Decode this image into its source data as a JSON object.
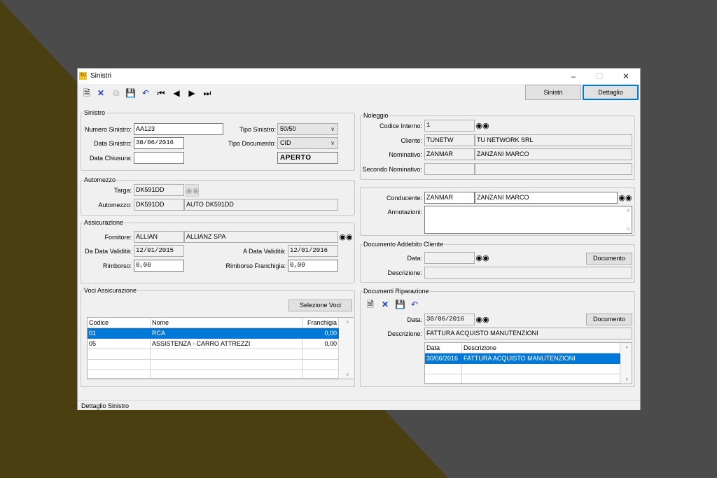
{
  "window": {
    "title": "Sinistri",
    "app_icon_text": "TU"
  },
  "tabs": [
    {
      "label": "Sinistri"
    },
    {
      "label": "Dettaglio"
    }
  ],
  "sinistro": {
    "legend": "Sinistro",
    "numero_label": "Numero Sinistro:",
    "numero_value": "AA123",
    "data_label": "Data Sinistro:",
    "data_value": "30/06/2016",
    "chiusura_label": "Data Chiusura:",
    "chiusura_value": "",
    "tipo_label": "Tipo Sinistro:",
    "tipo_value": "50/50",
    "tipodoc_label": "Tipo Documento:",
    "tipodoc_value": "CID",
    "stato": "APERTO"
  },
  "automezzo": {
    "legend": "Automezzo",
    "targa_label": "Targa:",
    "targa_value": "DK591DD",
    "auto_label": "Automezzo:",
    "auto_code": "DK591DD",
    "auto_desc": "AUTO DK591DD"
  },
  "assicurazione": {
    "legend": "Assicurazione",
    "fornitore_label": "Fornitore:",
    "fornitore_code": "ALLIAN",
    "fornitore_desc": "ALLIANZ SPA",
    "da_label": "Da Data Validità:",
    "da_value": "12/01/2015",
    "a_label": "A Data Validità:",
    "a_value": "12/01/2016",
    "rimborso_label": "Rimborso:",
    "rimborso_value": "0,00",
    "franchigia_label": "Rimborso Franchigia:",
    "franchigia_value": "0,00"
  },
  "voci": {
    "legend": "Voci Assicurazione",
    "button": "Selezione Voci",
    "headers": [
      "Codice",
      "Nome",
      "Franchigia"
    ],
    "rows": [
      {
        "codice": "01",
        "nome": "RCA",
        "franchigia": "0,00"
      },
      {
        "codice": "05",
        "nome": "ASSISTENZA - CARRO ATTREZZI",
        "franchigia": "0,00"
      }
    ]
  },
  "noleggio": {
    "legend": "Noleggio",
    "codice_label": "Codice Interno:",
    "codice_value": "1",
    "cliente_label": "Cliente:",
    "cliente_code": "TUNETW",
    "cliente_desc": "TU NETWORK SRL",
    "nominativo_label": "Nominativo:",
    "nominativo_code": "ZANMAR",
    "nominativo_desc": "ZANZANI MARCO",
    "secondo_label": "Secondo Nominativo:",
    "secondo_code": "",
    "secondo_desc": ""
  },
  "conducente": {
    "label": "Conducente:",
    "code": "ZANMAR",
    "desc": "ZANZANI MARCO",
    "annotazioni_label": "Annotazioni:",
    "annotazioni_value": ""
  },
  "addebito": {
    "legend": "Documento Addebito Cliente",
    "data_label": "Data:",
    "data_value": "",
    "descrizione_label": "Descrizione:",
    "descrizione_value": "",
    "button": "Documento"
  },
  "riparazione": {
    "legend": "Documenti Riparazione",
    "data_label": "Data:",
    "data_value": "30/06/2016",
    "descrizione_label": "Descrizione:",
    "descrizione_value": "FATTURA ACQUISTO MANUTENZIONI",
    "button": "Documento",
    "headers": [
      "Data",
      "Descrizione"
    ],
    "rows": [
      {
        "data": "30/06/2016",
        "descrizione": "FATTURA ACQUISTO MANUTENZIONI"
      }
    ]
  },
  "statusbar": {
    "text": "Dettaglio Sinistro"
  },
  "colors": {
    "selection": "#0078d7",
    "background": "#4b4b4b",
    "accent_triangle": "#4a3f10"
  },
  "icons": {
    "new": "new-document-icon",
    "delete": "delete-icon",
    "copy": "copy-icon",
    "save": "save-icon",
    "undo": "undo-icon",
    "find": "binoculars-icon"
  }
}
